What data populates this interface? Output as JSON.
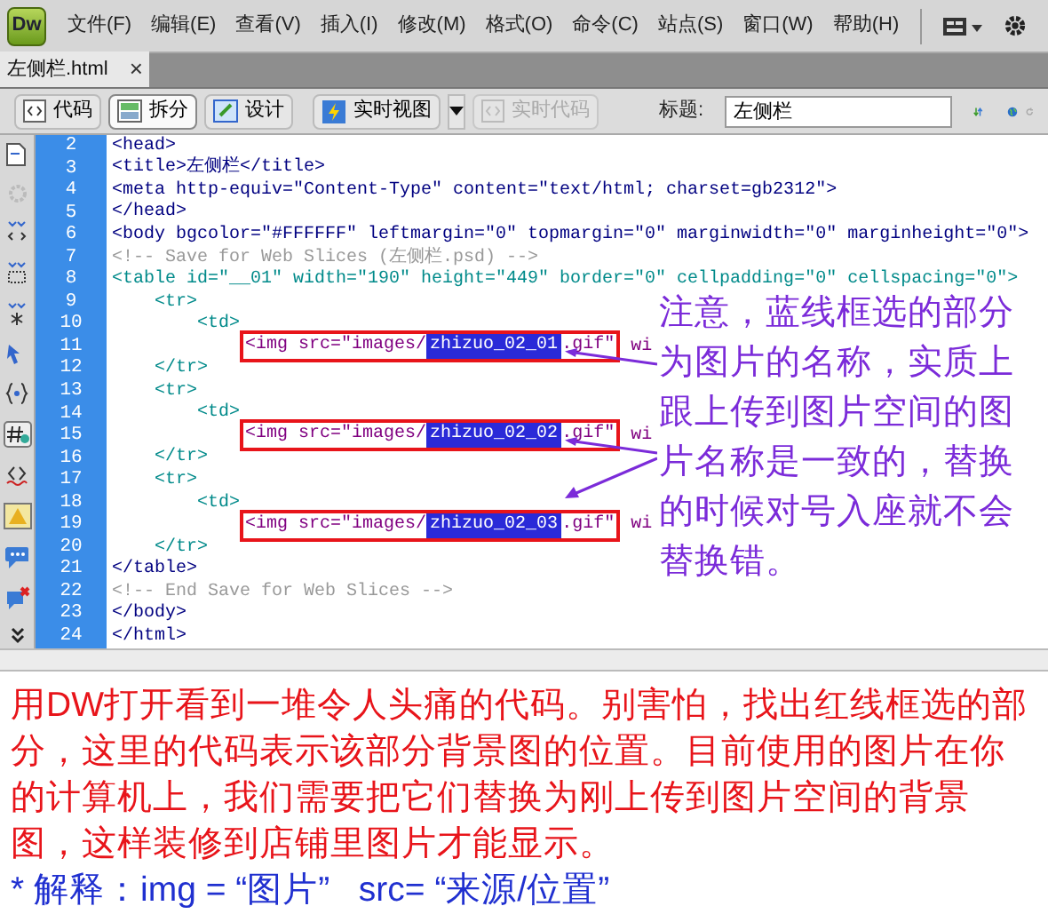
{
  "app_logo": "Dw",
  "menu": [
    "文件(F)",
    "编辑(E)",
    "查看(V)",
    "插入(I)",
    "修改(M)",
    "格式(O)",
    "命令(C)",
    "站点(S)",
    "窗口(W)",
    "帮助(H)"
  ],
  "document_tab": {
    "label": "左侧栏.html",
    "close": "×"
  },
  "view_buttons": [
    {
      "label": "代码",
      "selected": false
    },
    {
      "label": "拆分",
      "selected": true
    },
    {
      "label": "设计",
      "selected": false
    }
  ],
  "live_view": {
    "label": "实时视图"
  },
  "live_code": {
    "label": "实时代码",
    "disabled": true
  },
  "title_field": {
    "label": "标题:",
    "value": "左侧栏"
  },
  "code_lines": [
    {
      "number": "2",
      "kind": "head",
      "code": "<head>"
    },
    {
      "number": "3",
      "kind": "head",
      "code": "<title>左侧栏</title>"
    },
    {
      "number": "4",
      "kind": "head",
      "code": "<meta http-equiv=\"Content-Type\" content=\"text/html; charset=gb2312\">"
    },
    {
      "number": "5",
      "kind": "head",
      "code": "</head>"
    },
    {
      "number": "6",
      "kind": "head",
      "code": "<body bgcolor=\"#FFFFFF\" leftmargin=\"0\" topmargin=\"0\" marginwidth=\"0\" marginheight=\"0\">"
    },
    {
      "number": "7",
      "kind": "comment",
      "code": "<!-- Save for Web Slices (左侧栏.psd) -->"
    },
    {
      "number": "8",
      "kind": "table",
      "code": "<table id=\"__01\" width=\"190\" height=\"449\" border=\"0\" cellpadding=\"0\" cellspacing=\"0\">"
    },
    {
      "number": "9",
      "kind": "table",
      "code": "    <tr>"
    },
    {
      "number": "10",
      "kind": "table",
      "code": "        <td>"
    },
    {
      "number": "11",
      "kind": "image",
      "code": "            <img src=\"images/",
      "file": "zhizuo_02_01",
      "rest": ".gif\"",
      "after": " wi"
    },
    {
      "number": "12",
      "kind": "table",
      "code": "    </tr>"
    },
    {
      "number": "13",
      "kind": "table",
      "code": "    <tr>"
    },
    {
      "number": "14",
      "kind": "table",
      "code": "        <td>"
    },
    {
      "number": "15",
      "kind": "image",
      "code": "            <img src=\"images/",
      "file": "zhizuo_02_02",
      "rest": ".gif\"",
      "after": " wi"
    },
    {
      "number": "16",
      "kind": "table",
      "code": "    </tr>"
    },
    {
      "number": "17",
      "kind": "table",
      "code": "    <tr>"
    },
    {
      "number": "18",
      "kind": "table",
      "code": "        <td>"
    },
    {
      "number": "19",
      "kind": "image",
      "code": "            <img src=\"images/",
      "file": "zhizuo_02_03",
      "rest": ".gif\"",
      "after": " wi"
    },
    {
      "number": "20",
      "kind": "table",
      "code": "    </tr>"
    },
    {
      "number": "21",
      "kind": "head",
      "code": "</table>"
    },
    {
      "number": "22",
      "kind": "comment",
      "code": "<!-- End Save for Web Slices -->"
    },
    {
      "number": "23",
      "kind": "head",
      "code": "</body>"
    },
    {
      "number": "24",
      "kind": "head",
      "code": "</html>"
    }
  ],
  "annotation": "注意，蓝线框选的部分为图片的名称，实质上跟上传到图片空间的图片名称是一致的，替换的时候对号入座就不会替换错。",
  "caption": {
    "text": "用DW打开看到一堆令人头痛的代码。别害怕，找出红线框选的部分，这里的代码表示该部分背景图的位置。目前使用的图片在你的计算机上，我们需要把它们替换为刚上传到图片空间的背景图，这样装修到店铺里图片才能显示。",
    "note": "* 解释：img = “图片”   src= “来源/位置”"
  }
}
